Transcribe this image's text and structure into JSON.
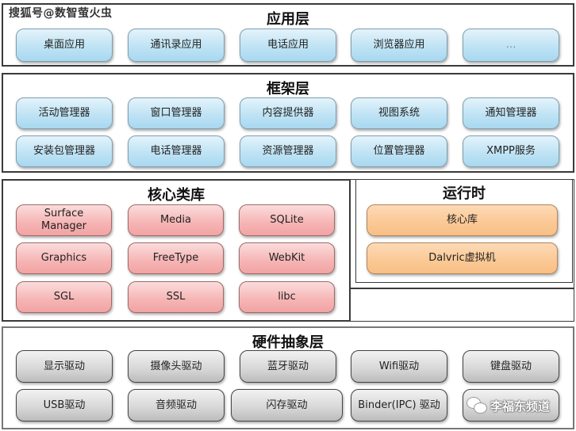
{
  "watermarks": {
    "top_left": "搜狐号@数智萤火虫",
    "bottom_right": "李福东频道",
    "bottom_right_icon": "wechat-icon"
  },
  "colors": {
    "application": "#bfe3f4",
    "framework": "#bfe3f4",
    "core_libraries": "#f6b4b4",
    "runtime": "#fbc894",
    "hal": "#d6d6d6"
  },
  "application_layer": {
    "title": "应用层",
    "items": [
      "桌面应用",
      "通讯录应用",
      "电话应用",
      "浏览器应用",
      "…"
    ]
  },
  "framework_layer": {
    "title": "框架层",
    "items": [
      "活动管理器",
      "窗口管理器",
      "内容提供器",
      "视图系统",
      "通知管理器",
      "安装包管理器",
      "电话管理器",
      "资源管理器",
      "位置管理器",
      "XMPP服务"
    ]
  },
  "core_libraries": {
    "title": "核心类库",
    "items": [
      "Surface Manager",
      "Media",
      "SQLite",
      "Graphics",
      "FreeType",
      "WebKit",
      "SGL",
      "SSL",
      "libc"
    ]
  },
  "runtime": {
    "title": "运行时",
    "items": [
      "核心库",
      "Dalvric虚拟机"
    ]
  },
  "hal_layer": {
    "title": "硬件抽象层",
    "items": [
      "显示驱动",
      "摄像头驱动",
      "蓝牙驱动",
      "Wifi驱动",
      "键盘驱动",
      "USB驱动",
      "音频驱动",
      "闪存驱动",
      "Binder(IPC) 驱动",
      ""
    ]
  }
}
